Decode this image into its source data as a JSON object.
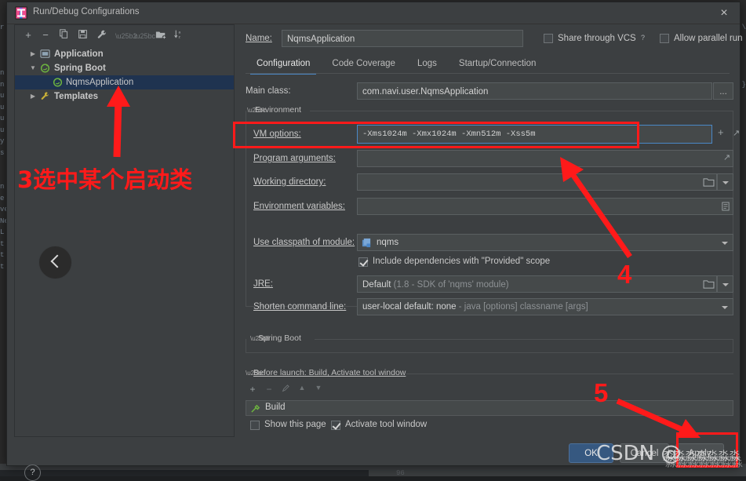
{
  "window": {
    "title": "Run/Debug Configurations",
    "icon": "intellij-idea-icon",
    "close_label": "×"
  },
  "sidebar": {
    "toolbar": [
      {
        "name": "add-configuration-button",
        "glyph": "+"
      },
      {
        "name": "remove-configuration-button",
        "glyph": "−"
      },
      {
        "name": "copy-configuration-button",
        "glyph": "❐"
      },
      {
        "name": "save-configuration-button",
        "glyph": "▣"
      },
      {
        "name": "edit-templates-button",
        "glyph": "🔧"
      },
      {
        "name": "move-up-button",
        "glyph": "▲"
      },
      {
        "name": "move-down-button",
        "glyph": "▼"
      },
      {
        "name": "move-into-folder-button",
        "glyph": "◱"
      },
      {
        "name": "sort-configurations-button",
        "glyph": "↓"
      }
    ],
    "tree": [
      {
        "label": "Application",
        "icon": "application-icon",
        "expand": "▶",
        "depth": 0,
        "selected": false
      },
      {
        "label": "Spring Boot",
        "icon": "spring-boot-icon",
        "expand": "▼",
        "depth": 0,
        "selected": false
      },
      {
        "label": "NqmsApplication",
        "icon": "spring-boot-icon",
        "expand": "",
        "depth": 1,
        "selected": true
      },
      {
        "label": "Templates",
        "icon": "wrench-icon",
        "expand": "▶",
        "depth": 0,
        "selected": false
      }
    ],
    "back_button": "collapse-pane-button",
    "help_button": "?"
  },
  "form": {
    "name_label": "Name:",
    "name_value": "NqmsApplication",
    "share_vcs_label": "Share through VCS",
    "share_vcs_checked": false,
    "share_vcs_help": "?",
    "allow_parallel_label": "Allow parallel run",
    "allow_parallel_checked": false,
    "tabs": [
      {
        "label": "Configuration",
        "active": true
      },
      {
        "label": "Code Coverage",
        "active": false
      },
      {
        "label": "Logs",
        "active": false
      },
      {
        "label": "Startup/Connection",
        "active": false
      }
    ],
    "main_class_label": "Main class:",
    "main_class_value": "com.navi.user.NqmsApplication",
    "main_class_browse": "...",
    "environment_section": "Environment",
    "vm_options_label": "VM options:",
    "vm_options_value": "-Xms1024m -Xmx1024m -Xmn512m -Xss5m",
    "vm_options_add": "+",
    "vm_options_expand": "↗",
    "program_args_label": "Program arguments:",
    "program_args_value": "",
    "program_args_expand": "↗",
    "working_dir_label": "Working directory:",
    "working_dir_value": "",
    "env_vars_label": "Environment variables:",
    "env_vars_value": "",
    "classpath_label": "Use classpath of module:",
    "classpath_value": "nqms",
    "classpath_icon": "module-icon",
    "include_provided_label": "Include dependencies with \"Provided\" scope",
    "include_provided_checked": true,
    "jre_label": "JRE:",
    "jre_value": "Default",
    "jre_value_hint": "(1.8 - SDK of 'nqms' module)",
    "shorten_label": "Shorten command line:",
    "shorten_value": "user-local default: none",
    "shorten_hint": "- java [options] classname [args]",
    "spring_boot_section": "Spring Boot",
    "before_launch_section": "Before launch: Build, Activate tool window",
    "before_launch_toolbar": [
      {
        "name": "before-launch-add-button",
        "glyph": "+"
      },
      {
        "name": "before-launch-remove-button",
        "glyph": "−"
      },
      {
        "name": "before-launch-edit-button",
        "glyph": "✐"
      },
      {
        "name": "before-launch-up-button",
        "glyph": "▲"
      },
      {
        "name": "before-launch-down-button",
        "glyph": "▼"
      }
    ],
    "before_launch_items": [
      {
        "label": "Build",
        "icon": "build-hammer-icon"
      }
    ],
    "show_page_label": "Show this page",
    "show_page_checked": false,
    "activate_tool_window_label": "Activate tool window",
    "activate_tool_window_checked": true
  },
  "footer": {
    "ok_label": "OK",
    "cancel_label": "Cancel",
    "apply_label": "Apply"
  },
  "annotations": {
    "accent_color": "#ff1a1a",
    "step3_text": "3选中某个启动类",
    "step4_text": "4",
    "step5_text": "5"
  },
  "watermark": {
    "primary": "CSDN @",
    "secondary": "淼淼淼淼淼淼淼"
  },
  "background": {
    "left_fragments": "r\n\n\n\nn\nn\nu\nu\nu\nu\ny\ns\n\n\nn\ne\nve\nNe\nL\nt\nt\nt",
    "right_fragments": "\\\n\n\n\n\n}\n\n\n\n\n\n\n\n",
    "line_number": "96"
  }
}
